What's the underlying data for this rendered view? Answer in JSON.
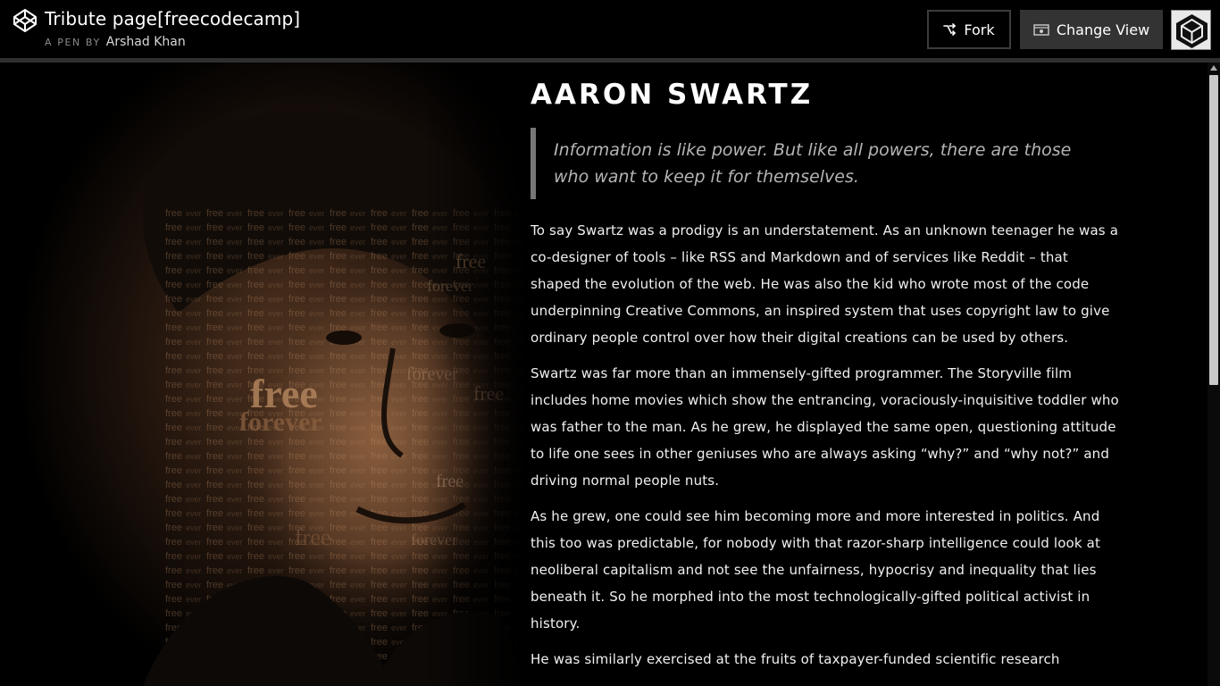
{
  "header": {
    "title": "Tribute page[freecodecamp]",
    "byline_prefix": "A PEN BY",
    "author": "Arshad Khan",
    "fork_label": "Fork",
    "change_view_label": "Change View",
    "logo_icon": "codepen-logo-icon",
    "fork_icon": "fork-icon",
    "view_icon": "eye-icon"
  },
  "tribute": {
    "name": "AARON SWARTZ",
    "quote": "Information is like power. But like all powers, there are those who want to keep it for themselves.",
    "paragraphs": [
      "To say Swartz was a prodigy is an understatement. As an unknown teenager he was a co-designer of tools – like RSS and Markdown and of services like Reddit – that shaped the evolution of the web. He was also the kid who wrote most of the code underpinning Creative Commons, an inspired system that uses copyright law to give ordinary people control over how their digital creations can be used by others.",
      "Swartz was far more than an immensely-gifted programmer. The Storyville film includes home movies which show the entrancing, voraciously-inquisitive toddler who was father to the man. As he grew, he displayed the same open, questioning attitude to life one sees in other geniuses who are always asking “why?” and “why not?” and driving normal people nuts.",
      "As he grew, one could see him becoming more and more interested in politics. And this too was predictable, for nobody with that razor-sharp intelligence could look at neoliberal capitalism and not see the unfairness, hypocrisy and inequality that lies beneath it. So he morphed into the most technologically-gifted political activist in history.",
      "He was similarly exercised at the fruits of taxpayer-funded scientific research"
    ]
  },
  "colors": {
    "background": "#000000",
    "quote_border": "#777777",
    "quote_text": "#b5b5b5",
    "change_view_bg": "#333333"
  }
}
